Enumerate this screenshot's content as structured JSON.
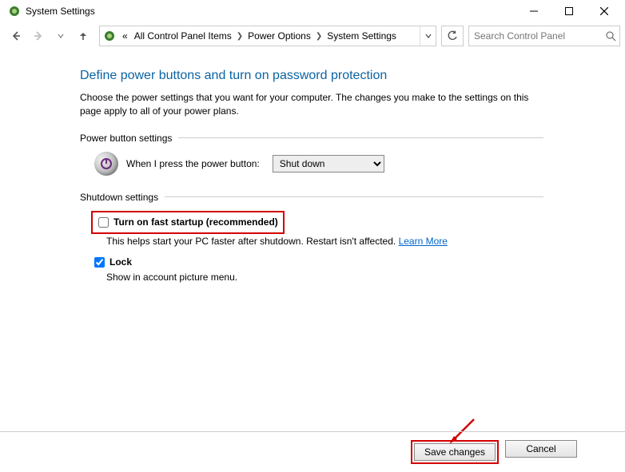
{
  "window": {
    "title": "System Settings"
  },
  "breadcrumb": {
    "prefix": "«",
    "items": [
      "All Control Panel Items",
      "Power Options",
      "System Settings"
    ]
  },
  "search": {
    "placeholder": "Search Control Panel"
  },
  "main": {
    "heading": "Define power buttons and turn on password protection",
    "description": "Choose the power settings that you want for your computer. The changes you make to the settings on this page apply to all of your power plans.",
    "section_power_label": "Power button settings",
    "power_button_label": "When I press the power button:",
    "power_button_value": "Shut down",
    "section_shutdown_label": "Shutdown settings",
    "fast_startup": {
      "label": "Turn on fast startup (recommended)",
      "help": "This helps start your PC faster after shutdown. Restart isn't affected. ",
      "learn_more": "Learn More"
    },
    "lock": {
      "label": "Lock",
      "help": "Show in account picture menu."
    }
  },
  "footer": {
    "save": "Save changes",
    "cancel": "Cancel"
  }
}
